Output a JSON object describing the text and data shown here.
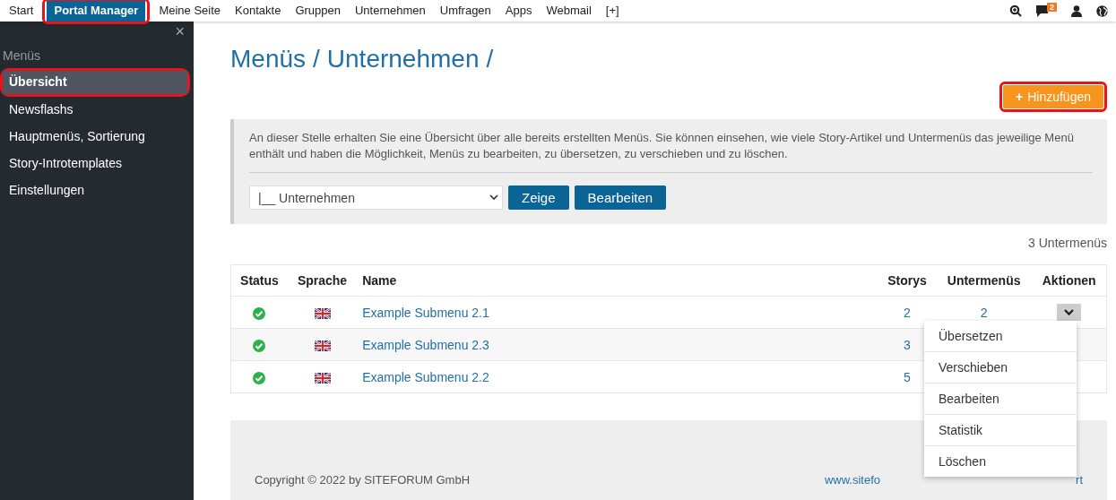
{
  "topnav": {
    "items": [
      {
        "label": "Start",
        "selected": false,
        "highlighted": false
      },
      {
        "label": "Portal Manager",
        "selected": true,
        "highlighted": true
      },
      {
        "label": "Meine Seite",
        "selected": false,
        "highlighted": false
      },
      {
        "label": "Kontakte",
        "selected": false,
        "highlighted": false
      },
      {
        "label": "Gruppen",
        "selected": false,
        "highlighted": false
      },
      {
        "label": "Unternehmen",
        "selected": false,
        "highlighted": false
      },
      {
        "label": "Umfragen",
        "selected": false,
        "highlighted": false
      },
      {
        "label": "Apps",
        "selected": false,
        "highlighted": false
      },
      {
        "label": "Webmail",
        "selected": false,
        "highlighted": false
      },
      {
        "label": "[+]",
        "selected": false,
        "highlighted": false
      }
    ],
    "icons": [
      {
        "kind": "search"
      },
      {
        "kind": "messages",
        "badge": "2"
      },
      {
        "kind": "user"
      },
      {
        "kind": "globe"
      }
    ]
  },
  "sidebar": {
    "close": "×",
    "heading": "Menüs",
    "items": [
      {
        "label": "Übersicht",
        "selected": true,
        "highlighted": true
      },
      {
        "label": "Newsflashs",
        "selected": false,
        "highlighted": false
      },
      {
        "label": "Hauptmenüs, Sortierung",
        "selected": false,
        "highlighted": false
      },
      {
        "label": "Story-Introtemplates",
        "selected": false,
        "highlighted": false
      },
      {
        "label": "Einstellungen",
        "selected": false,
        "highlighted": false
      }
    ]
  },
  "breadcrumb": [
    {
      "label": "Menüs",
      "separator": "/"
    },
    {
      "label": "Unternehmen",
      "separator": "/"
    }
  ],
  "add_button": {
    "label": "Hinzufügen",
    "icon": "+",
    "highlighted": true
  },
  "info": {
    "text": "An dieser Stelle erhalten Sie eine Übersicht über alle bereits erstellten Menüs. Sie können einsehen, wie viele Story-Artikel und Untermenüs das jeweilige Menü enthält und haben die Möglichkeit, Menüs zu bearbeiten, zu übersetzen, zu verschieben und zu löschen.",
    "select": "|__ Unternehmen",
    "buttons": [
      "Zeige",
      "Bearbeiten"
    ]
  },
  "count": "3 Untermenüs",
  "table": {
    "columns": [
      "Status",
      "Sprache",
      "Name",
      "Storys",
      "Untermenüs",
      "Aktionen"
    ],
    "rows": [
      {
        "name": "Example Submenu 2.1",
        "storys": "2",
        "submenus": "2",
        "menu_open": true
      },
      {
        "name": "Example Submenu 2.3",
        "storys": "3",
        "menu_open": false
      },
      {
        "name": "Example Submenu 2.2",
        "storys": "5",
        "menu_open": false
      }
    ]
  },
  "actions_menu": [
    "Übersetzen",
    "Verschieben",
    "Bearbeiten",
    "Statistik",
    "Löschen"
  ],
  "footer": {
    "copyright": "Copyright © 2022 by SITEFORUM GmbH",
    "link_start": "www.sitefo",
    "link_end": "rt"
  }
}
